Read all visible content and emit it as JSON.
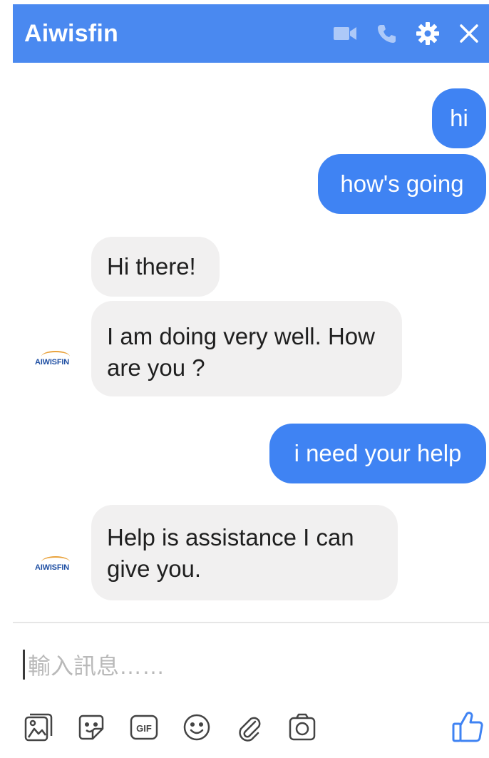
{
  "header": {
    "title": "Aiwisfin",
    "icons": [
      "video-icon",
      "phone-icon",
      "gear-icon",
      "close-icon"
    ],
    "color": "#4a89f0"
  },
  "messages": [
    {
      "from": "user",
      "text": "hi"
    },
    {
      "from": "user",
      "text": "how's going"
    },
    {
      "from": "bot",
      "text": "Hi there!"
    },
    {
      "from": "bot",
      "text": "I am doing very well. How are you  ?"
    },
    {
      "from": "user",
      "text": "i need your help"
    },
    {
      "from": "bot",
      "text": "Help is assistance I can give you."
    }
  ],
  "bot_avatar": {
    "label": "AIWISFIN"
  },
  "composer": {
    "placeholder": "輸入訊息……"
  },
  "toolbar": {
    "icons": [
      "image-icon",
      "sticker-icon",
      "gif-icon",
      "emoji-icon",
      "attachment-icon",
      "camera-icon",
      "thumbs-up-icon"
    ],
    "gif_label": "GIF"
  },
  "colors": {
    "accent": "#3f83f3",
    "bot_bubble": "#f1f0f0"
  }
}
